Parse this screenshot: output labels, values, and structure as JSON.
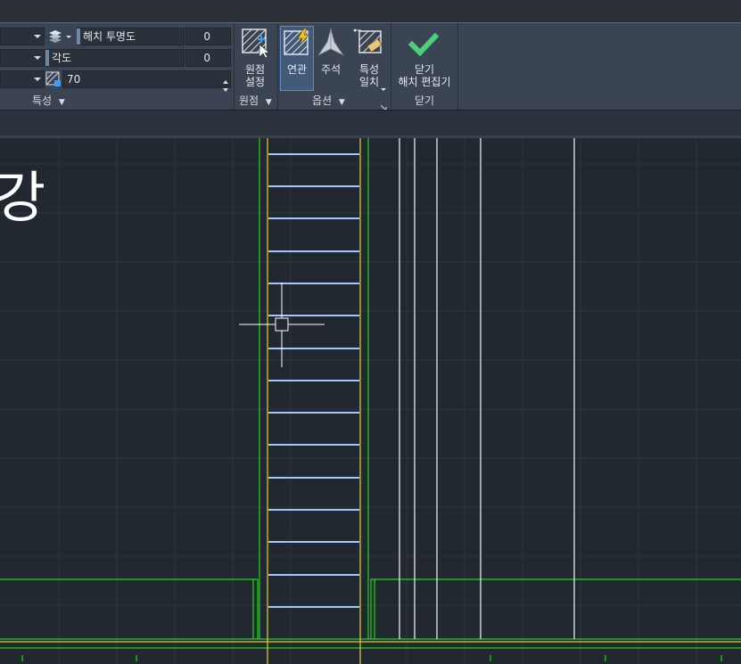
{
  "properties_panel": {
    "transparency_label": "해치 투명도",
    "transparency_value": "0",
    "angle_label": "각도",
    "angle_value": "0",
    "scale_value": "70",
    "title": "특성"
  },
  "origin_panel": {
    "set_origin_label_line1": "원점",
    "set_origin_label_line2": "설정",
    "title": "원점"
  },
  "options_panel": {
    "associative_label": "연관",
    "annotative_label": "주석",
    "match_properties_line1": "특성",
    "match_properties_line2": "일치",
    "title": "옵션"
  },
  "close_panel": {
    "close_label_line1": "닫기",
    "close_label_line2": "해치 편집기",
    "title": "닫기"
  },
  "canvas": {
    "partial_text": "강"
  },
  "colors": {
    "grid": "#2d3540",
    "green_lines": "#1ed51e",
    "yellow_lines": "#e6d21e",
    "hatch_lines": "#a9c4ff",
    "white_lines": "#e8e8e8",
    "accent_blue": "#3c6f9e",
    "check_green": "#4ccf7a"
  }
}
